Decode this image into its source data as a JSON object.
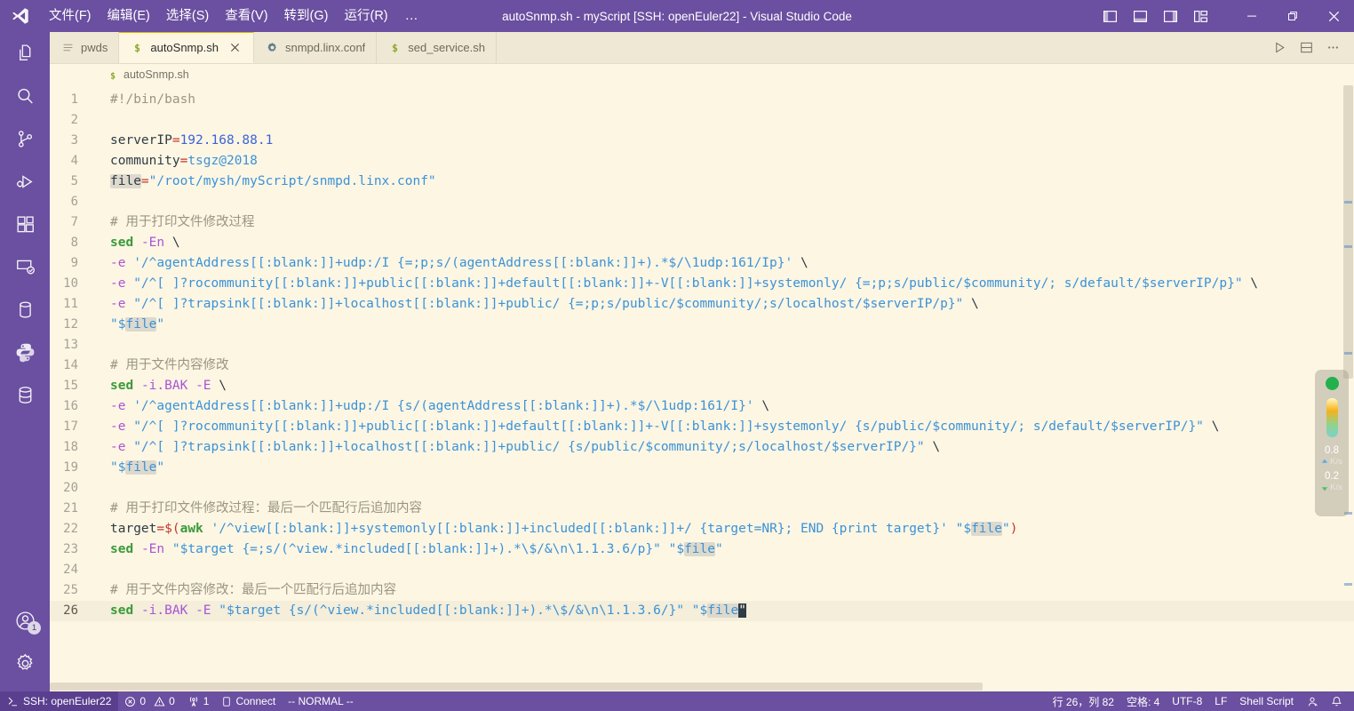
{
  "window": {
    "title": "autoSnmp.sh - myScript [SSH: openEuler22] - Visual Studio Code",
    "accent_titlebar": "#6b4fa0",
    "editor_background": "#fdf6e3"
  },
  "menubar": {
    "items": [
      {
        "label": "文件(F)",
        "name": "menu-file"
      },
      {
        "label": "编辑(E)",
        "name": "menu-edit"
      },
      {
        "label": "选择(S)",
        "name": "menu-selection"
      },
      {
        "label": "查看(V)",
        "name": "menu-view"
      },
      {
        "label": "转到(G)",
        "name": "menu-go"
      },
      {
        "label": "运行(R)",
        "name": "menu-run"
      },
      {
        "label": "…",
        "name": "menu-more"
      }
    ]
  },
  "titlebar_actions": {
    "toggle_primary_sidebar": "切换主侧栏",
    "toggle_panel": "切换面板",
    "toggle_secondary_sidebar": "切换辅助侧栏",
    "customize_layout": "自定义布局",
    "minimize": "最小化",
    "restore": "还原",
    "close": "关闭"
  },
  "activitybar": {
    "items": [
      {
        "label": "资源管理器",
        "icon": "files-icon"
      },
      {
        "label": "搜索",
        "icon": "search-icon"
      },
      {
        "label": "源代码管理",
        "icon": "source-control-icon"
      },
      {
        "label": "运行和调试",
        "icon": "run-debug-icon"
      },
      {
        "label": "扩展",
        "icon": "extensions-icon"
      },
      {
        "label": "远程资源管理器",
        "icon": "remote-explorer-icon"
      },
      {
        "label": "数据库",
        "icon": "database-icon"
      },
      {
        "label": "Python",
        "icon": "python-icon"
      },
      {
        "label": "SQL 工具",
        "icon": "sqltools-icon"
      }
    ],
    "bottom": [
      {
        "label": "账户",
        "icon": "account-icon",
        "badge": "1"
      },
      {
        "label": "管理",
        "icon": "gear-icon",
        "badge": ""
      }
    ]
  },
  "tabs": [
    {
      "label": "pwds",
      "icon": "list-icon",
      "active": false,
      "closable": false
    },
    {
      "label": "autoSnmp.sh",
      "icon": "shell-icon",
      "active": true,
      "closable": true
    },
    {
      "label": "snmpd.linx.conf",
      "icon": "gear-icon",
      "active": false,
      "closable": false
    },
    {
      "label": "sed_service.sh",
      "icon": "shell-icon",
      "active": false,
      "closable": false
    }
  ],
  "editor_actions": [
    {
      "label": "运行",
      "icon": "play-icon"
    },
    {
      "label": "拆分编辑器",
      "icon": "split-editor-icon"
    },
    {
      "label": "更多操作...",
      "icon": "ellipsis-icon"
    }
  ],
  "breadcrumb": {
    "icon": "shell-icon",
    "path": "autoSnmp.sh"
  },
  "code": {
    "language": "Shell Script",
    "cursor_line": 26,
    "lines": [
      {
        "n": "1",
        "html": "<span class=\"t-cmt\">#!/bin/bash</span>"
      },
      {
        "n": "2",
        "html": ""
      },
      {
        "n": "3",
        "html": "<span class=\"t-var\">serverIP</span><span class=\"t-op\">=</span><span class=\"t-num\">192.168.88.1</span>"
      },
      {
        "n": "4",
        "html": "<span class=\"t-var\">community</span><span class=\"t-op\">=</span><span class=\"t-str\">tsgz@2018</span>"
      },
      {
        "n": "5",
        "html": "<span class=\"t-var hl\">file</span><span class=\"t-op\">=</span><span class=\"t-str\">\"/root/mysh/myScript/snmpd.linx.conf\"</span>"
      },
      {
        "n": "6",
        "html": ""
      },
      {
        "n": "7",
        "html": "<span class=\"t-cmt\"># 用于打印文件修改过程</span>"
      },
      {
        "n": "8",
        "html": "<span class=\"t-kw\">sed</span> <span class=\"t-opt\">-En</span> <span class=\"t-plain\">\\</span>"
      },
      {
        "n": "9",
        "html": "<span class=\"t-opt\">-e</span> <span class=\"t-str\">'/^agentAddress[[:blank:]]+udp:/I {=;p;s/(agentAddress[[:blank:]]+).*$/\\1udp:161/Ip}'</span> <span class=\"t-plain\">\\</span>"
      },
      {
        "n": "10",
        "html": "<span class=\"t-opt\">-e</span> <span class=\"t-str\">\"/^[ ]?rocommunity[[:blank:]]+public[[:blank:]]+default[[:blank:]]+-V[[:blank:]]+systemonly/ {=;p;s/public/$community/; s/default/$serverIP/p}\"</span> <span class=\"t-plain\">\\</span>"
      },
      {
        "n": "11",
        "html": "<span class=\"t-opt\">-e</span> <span class=\"t-str\">\"/^[ ]?trapsink[[:blank:]]+localhost[[:blank:]]+public/ {=;p;s/public/$community/;s/localhost/$serverIP/p}\"</span> <span class=\"t-plain\">\\</span>"
      },
      {
        "n": "12",
        "html": "<span class=\"t-str\">\"$</span><span class=\"t-str hl\">file</span><span class=\"t-str\">\"</span>"
      },
      {
        "n": "13",
        "html": ""
      },
      {
        "n": "14",
        "html": "<span class=\"t-cmt\"># 用于文件内容修改</span>"
      },
      {
        "n": "15",
        "html": "<span class=\"t-kw\">sed</span> <span class=\"t-opt\">-i.BAK</span> <span class=\"t-opt\">-E</span> <span class=\"t-plain\">\\</span>"
      },
      {
        "n": "16",
        "html": "<span class=\"t-opt\">-e</span> <span class=\"t-str\">'/^agentAddress[[:blank:]]+udp:/I {s/(agentAddress[[:blank:]]+).*$/\\1udp:161/I}'</span> <span class=\"t-plain\">\\</span>"
      },
      {
        "n": "17",
        "html": "<span class=\"t-opt\">-e</span> <span class=\"t-str\">\"/^[ ]?rocommunity[[:blank:]]+public[[:blank:]]+default[[:blank:]]+-V[[:blank:]]+systemonly/ {s/public/$community/; s/default/$serverIP/}\"</span> <span class=\"t-plain\">\\</span>"
      },
      {
        "n": "18",
        "html": "<span class=\"t-opt\">-e</span> <span class=\"t-str\">\"/^[ ]?trapsink[[:blank:]]+localhost[[:blank:]]+public/ {s/public/$community/;s/localhost/$serverIP/}\"</span> <span class=\"t-plain\">\\</span>"
      },
      {
        "n": "19",
        "html": "<span class=\"t-str\">\"$</span><span class=\"t-str hl\">file</span><span class=\"t-str\">\"</span>"
      },
      {
        "n": "20",
        "html": ""
      },
      {
        "n": "21",
        "html": "<span class=\"t-cmt\"># 用于打印文件修改过程：最后一个匹配行后追加内容</span>"
      },
      {
        "n": "22",
        "html": "<span class=\"t-var\">target</span><span class=\"t-op\">=</span><span class=\"t-op\">$(</span><span class=\"t-kw\">awk</span> <span class=\"t-str\">'/^view[[:blank:]]+systemonly[[:blank:]]+included[[:blank:]]+/ {target=NR}; END {print target}'</span> <span class=\"t-str\">\"$</span><span class=\"t-str hl\">file</span><span class=\"t-str\">\"</span><span class=\"t-op\">)</span>"
      },
      {
        "n": "23",
        "html": "<span class=\"t-kw\">sed</span> <span class=\"t-opt\">-En</span> <span class=\"t-str\">\"$target {=;s/(^view.*included[[:blank:]]+).*\\$/&amp;\\n\\1.1.3.6/p}\"</span> <span class=\"t-str\">\"$</span><span class=\"t-str hl\">file</span><span class=\"t-str\">\"</span>"
      },
      {
        "n": "24",
        "html": ""
      },
      {
        "n": "25",
        "html": "<span class=\"t-cmt\"># 用于文件内容修改：最后一个匹配行后追加内容</span>"
      },
      {
        "n": "26",
        "html": "<span class=\"t-kw\">sed</span> <span class=\"t-opt\">-i.BAK</span> <span class=\"t-opt\">-E</span> <span class=\"t-str\">\"$target {s/(^view.*included[[:blank:]]+).*\\$/&amp;\\n\\1.1.3.6/}\"</span> <span class=\"t-str\">\"$</span><span class=\"t-str hl\">file</span><span class=\"cursorblk\">\"</span>"
      }
    ]
  },
  "network_widget": {
    "status_dot_color": "#22b14c",
    "upload_value": "0.8",
    "upload_unit": "K/s",
    "download_value": "0.2",
    "download_unit": "K/s"
  },
  "statusbar": {
    "remote": "SSH: openEuler22",
    "errors": "0",
    "warnings": "0",
    "ports": "1",
    "connect": "Connect",
    "mode": "-- NORMAL --",
    "position": "行 26，列 82",
    "indentation": "空格: 4",
    "encoding": "UTF-8",
    "eol": "LF",
    "language": "Shell Script",
    "feedback": "发送反馈",
    "notifications": "通知"
  }
}
